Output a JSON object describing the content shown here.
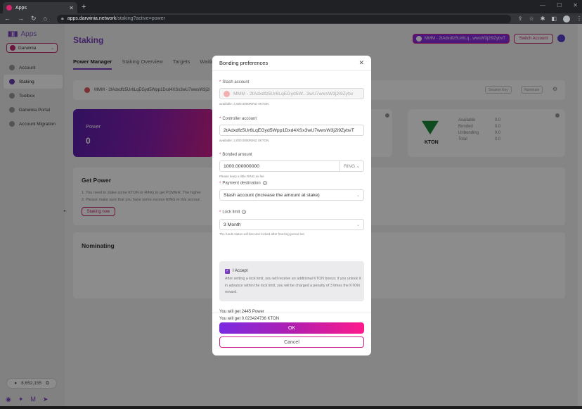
{
  "browser": {
    "tab_title": "Apps",
    "url_host": "apps.darwinia.network",
    "url_path": "/staking?active=power"
  },
  "sidebar": {
    "logo_text": "Apps",
    "network": "Darwinia",
    "items": [
      {
        "label": "Account",
        "icon": "account-icon"
      },
      {
        "label": "Staking",
        "icon": "staking-icon",
        "active": true
      },
      {
        "label": "Toolbox",
        "icon": "toolbox-icon"
      },
      {
        "label": "Darwinia Portal",
        "icon": "portal-icon"
      },
      {
        "label": "Account Migration",
        "icon": "migration-icon"
      }
    ],
    "balance": "8,652,155"
  },
  "header": {
    "title": "Staking",
    "account_chip": "MMM - 2tAdxdfz5Ur6Lq...wwsW3j2i9ZybvT",
    "switch_label": "Switch Account"
  },
  "tabs": [
    "Power Manager",
    "Staking Overview",
    "Targets",
    "Waiting"
  ],
  "stash_bar": {
    "account": "MMM - 2tAdxdfz5Ur6LqEGyd5Wpp1Dxd4XSx3wU7wwsW3j2i",
    "btn1": "Session Key",
    "btn2": "Nominate"
  },
  "power_card": {
    "label": "Power",
    "value": "0"
  },
  "kton_card": {
    "name": "KTON",
    "rows": [
      {
        "k": "Available",
        "v": "0.0"
      },
      {
        "k": "Bonded",
        "v": "0.0"
      },
      {
        "k": "Unbonding",
        "v": "0.0"
      },
      {
        "k": "Total",
        "v": "0.0"
      }
    ]
  },
  "get_power": {
    "title": "Get Power",
    "line1": "1. You need to stake some KTON or RING to get POWER. The higher",
    "line2": "2. Please make sure that you have some excess RING in this accoun",
    "button": "Staking now"
  },
  "nominating": {
    "title": "Nominating"
  },
  "modal": {
    "title": "Bonding preferences",
    "stash_label": "Stash account",
    "stash_value": "MMM - 2tAdxdfz5Ur6LqEGyd5W...3wU7wwsW3j2i9Zybv",
    "stash_available": "available: 2,000.0000RING  0KTON",
    "controller_label": "Controller account",
    "controller_value": "2tAdxdfz5Ur6LqEGyd5Wpp1Dxd4XSx3wU7wwsW3j2i9ZybvT",
    "controller_available": "available: 2,000.0000RING  0KTON",
    "bonded_label": "Bonded amount",
    "bonded_value": "1000.000000000",
    "bonded_unit": "RING",
    "bonded_hint": "Please keep a little RING as fee",
    "payment_label": "Payment destination",
    "payment_value": "Stash account (increase the amount at stake)",
    "lock_label": "Lock limit",
    "lock_value": "3 Month",
    "lock_hint": "The funds status will become locked after freezing period set",
    "accept_title": "I Accept",
    "accept_desc": "After setting a lock limit, you will receive an additional KTON bonus; if you unlock it in advance within the lock limit, you will be charged a penalty of 3 times the KTON reward.",
    "result_power": "You will get 2445 Power",
    "result_kton": "You will get 0.023424736 KTON",
    "ok_label": "OK",
    "cancel_label": "Cancel"
  }
}
